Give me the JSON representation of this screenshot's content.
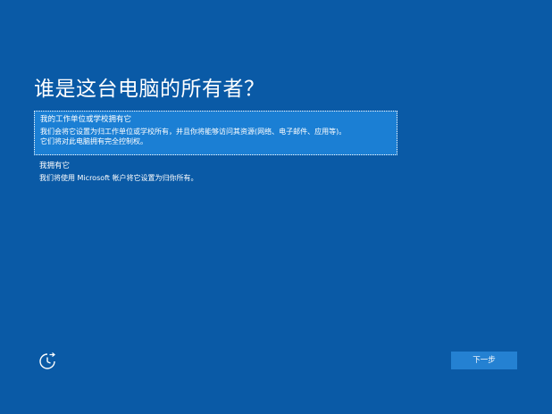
{
  "page": {
    "title": "谁是这台电脑的所有者？"
  },
  "options": [
    {
      "title": "我的工作单位或学校拥有它",
      "description_line1": "我们会将它设置为归工作单位或学校所有，并且你将能够访问其资源(网络、电子邮件、应用等)。",
      "description_line2": "它们将对此电脑拥有完全控制权。",
      "selected": true
    },
    {
      "title": "我拥有它",
      "description_line1": "我们将使用 Microsoft 帐户将它设置为归你所有。",
      "selected": false
    }
  ],
  "footer": {
    "accessibility_icon": "accessibility-clock-icon",
    "next_label": "下一步"
  },
  "colors": {
    "background": "#0a5aa6",
    "selected_option": "#1b7fd4",
    "next_button": "#2481d2",
    "text": "#ffffff"
  }
}
